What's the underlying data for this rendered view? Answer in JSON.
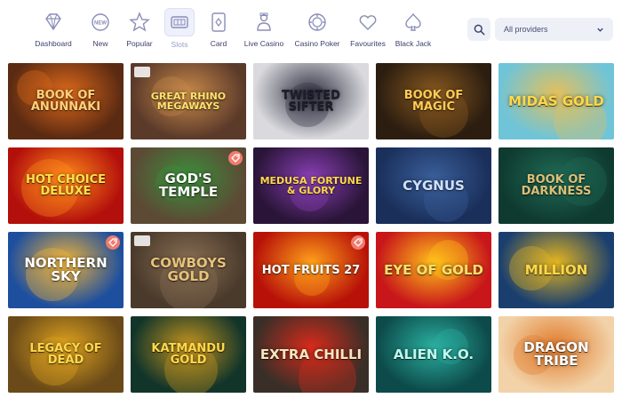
{
  "nav": {
    "items": [
      {
        "label": "Dashboard",
        "icon": "diamond-icon"
      },
      {
        "label": "New",
        "icon": "new-badge-icon"
      },
      {
        "label": "Popular",
        "icon": "star-icon"
      },
      {
        "label": "Slots",
        "icon": "slot-machine-icon",
        "active": true
      },
      {
        "label": "Card",
        "icon": "playing-card-icon"
      },
      {
        "label": "Live Casino",
        "icon": "dealer-icon"
      },
      {
        "label": "Casino Poker",
        "icon": "poker-chip-icon"
      },
      {
        "label": "Favourites",
        "icon": "heart-icon"
      },
      {
        "label": "Black Jack",
        "icon": "spade-icon"
      }
    ]
  },
  "search": {
    "icon": "search-icon"
  },
  "provider_filter": {
    "value": "All providers",
    "icon": "chevron-down-icon"
  },
  "games": [
    {
      "title": "Book of Anunnaki",
      "bg": "#5a2a12",
      "accent": "#e06a1b",
      "fg": "#ffd27a"
    },
    {
      "title": "Great Rhino Megaways",
      "bg": "#5b3a2a",
      "accent": "#c98a4a",
      "fg": "#ffe36b",
      "provider_mark": true
    },
    {
      "title": "Twisted Sifter",
      "bg": "#d9d9de",
      "accent": "#333344",
      "fg": "#1d1d2b"
    },
    {
      "title": "Book of Magic",
      "bg": "#2b1d10",
      "accent": "#8a5a20",
      "fg": "#ffcc55"
    },
    {
      "title": "Midas Gold",
      "bg": "#6fc4d8",
      "accent": "#e4c05a",
      "fg": "#ffd84a"
    },
    {
      "title": "Hot Choice Deluxe",
      "bg": "#b3100c",
      "accent": "#ff8c1a",
      "fg": "#ffe04a"
    },
    {
      "title": "God's Temple",
      "bg": "#5c4a35",
      "accent": "#3b8f3b",
      "fg": "#ffffff",
      "badge": true
    },
    {
      "title": "Medusa Fortune & Glory",
      "bg": "#2a1538",
      "accent": "#8a3fb5",
      "fg": "#ffd84a"
    },
    {
      "title": "Cygnus",
      "bg": "#1a2f5a",
      "accent": "#3a5f9a",
      "fg": "#cfe0ff"
    },
    {
      "title": "Book of Darkness",
      "bg": "#0f3a2f",
      "accent": "#1f6b55",
      "fg": "#d8c078"
    },
    {
      "title": "Northern Sky",
      "bg": "#1e4f9e",
      "accent": "#f0b43a",
      "fg": "#ffffff",
      "badge": true
    },
    {
      "title": "Cowboys Gold",
      "bg": "#4a3a2b",
      "accent": "#8a7055",
      "fg": "#e8c27a",
      "provider_mark": true
    },
    {
      "title": "Hot Fruits 27",
      "bg": "#b81208",
      "accent": "#ffa01a",
      "fg": "#ffffff",
      "badge": true
    },
    {
      "title": "Eye of Gold",
      "bg": "#c8161a",
      "accent": "#ffc21a",
      "fg": "#ffe06a"
    },
    {
      "title": "Million",
      "bg": "#1a3f6e",
      "accent": "#e4b520",
      "fg": "#ffd84a"
    },
    {
      "title": "Legacy of Dead",
      "bg": "#6a4a18",
      "accent": "#e0a420",
      "fg": "#ffd84a"
    },
    {
      "title": "Katmandu Gold",
      "bg": "#12352a",
      "accent": "#c8961e",
      "fg": "#ffd84a"
    },
    {
      "title": "Extra Chilli",
      "bg": "#3a2f28",
      "accent": "#d82a1a",
      "fg": "#f6e6c0"
    },
    {
      "title": "Alien K.O.",
      "bg": "#0d4a4a",
      "accent": "#2ab0a0",
      "fg": "#bff8ee"
    },
    {
      "title": "Dragon Tribe",
      "bg": "#f2d2a8",
      "accent": "#e07a2a",
      "fg": "#ffffff"
    }
  ]
}
